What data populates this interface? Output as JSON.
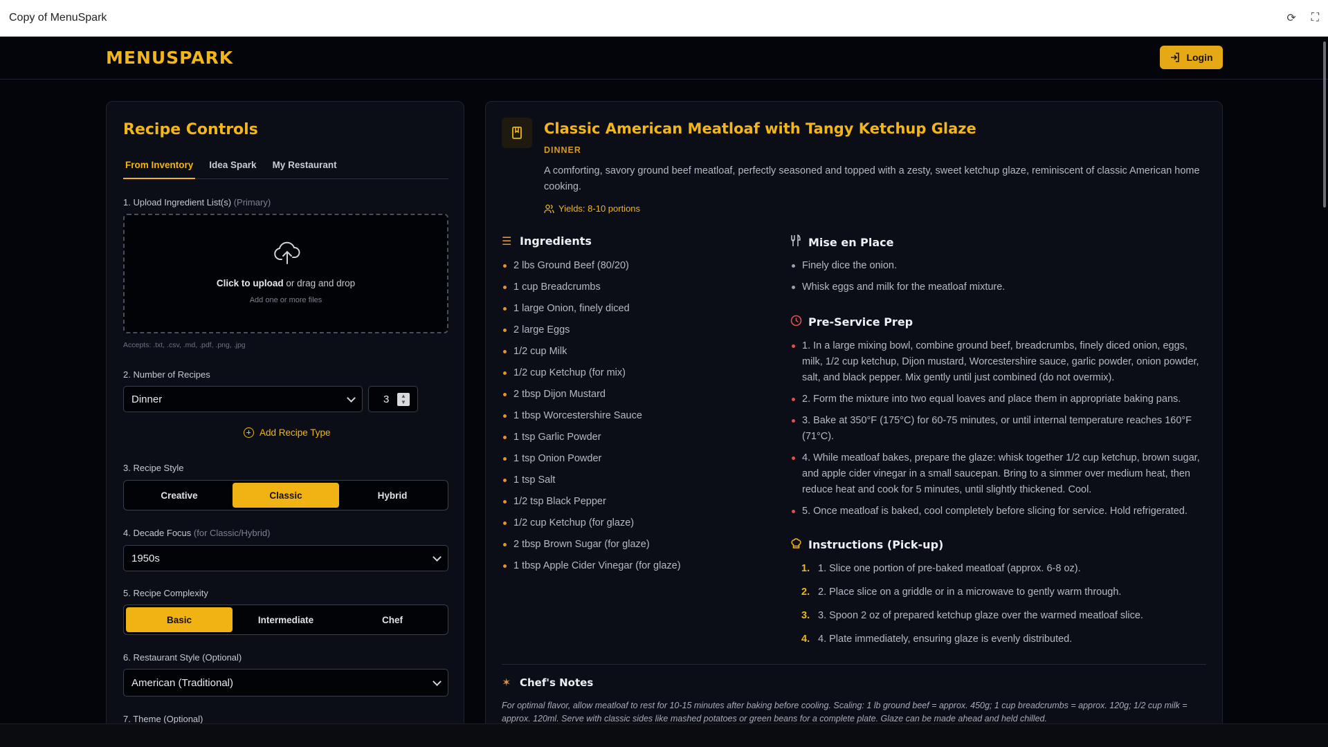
{
  "window": {
    "title": "Copy of MenuSpark",
    "refresh_icon": "refresh-icon",
    "fullscreen_icon": "fullscreen-icon"
  },
  "header": {
    "logo": "MENUSPARK",
    "login_label": "Login"
  },
  "controls": {
    "title": "Recipe Controls",
    "tabs": [
      {
        "label": "From Inventory",
        "active": true
      },
      {
        "label": "Idea Spark",
        "active": false
      },
      {
        "label": "My Restaurant",
        "active": false
      }
    ],
    "upload": {
      "label": "1. Upload Ingredient List(s)",
      "label_hint": "(Primary)",
      "click_text": "Click to upload",
      "drag_text": " or drag and drop",
      "sub_text": "Add one or more files",
      "accepts": "Accepts: .txt, .csv, .md, .pdf, .png, .jpg"
    },
    "num_recipes": {
      "label": "2. Number of Recipes",
      "type_value": "Dinner",
      "count": "3",
      "add_label": "Add Recipe Type"
    },
    "style": {
      "label": "3. Recipe Style",
      "options": [
        "Creative",
        "Classic",
        "Hybrid"
      ],
      "selected": "Classic"
    },
    "decade": {
      "label": "4. Decade Focus",
      "label_hint": "(for Classic/Hybrid)",
      "value": "1950s"
    },
    "complexity": {
      "label": "5. Recipe Complexity",
      "options": [
        "Basic",
        "Intermediate",
        "Chef"
      ],
      "selected": "Basic"
    },
    "restaurant_style": {
      "label": "6. Restaurant Style (Optional)",
      "value": "American (Traditional)"
    },
    "theme": {
      "label": "7. Theme (Optional)"
    }
  },
  "recipe": {
    "title": "Classic American Meatloaf with Tangy Ketchup Glaze",
    "type": "DINNER",
    "description": "A comforting, savory ground beef meatloaf, perfectly seasoned and topped with a zesty, sweet ketchup glaze, reminiscent of classic American home cooking.",
    "yields": "Yields: 8-10 portions",
    "ingredients_title": "Ingredients",
    "ingredients": [
      "2 lbs Ground Beef (80/20)",
      "1 cup Breadcrumbs",
      "1 large Onion, finely diced",
      "2 large Eggs",
      "1/2 cup Milk",
      "1/2 cup Ketchup (for mix)",
      "2 tbsp Dijon Mustard",
      "1 tbsp Worcestershire Sauce",
      "1 tsp Garlic Powder",
      "1 tsp Onion Powder",
      "1 tsp Salt",
      "1/2 tsp Black Pepper",
      "1/2 cup Ketchup (for glaze)",
      "2 tbsp Brown Sugar (for glaze)",
      "1 tbsp Apple Cider Vinegar (for glaze)"
    ],
    "mise_title": "Mise en Place",
    "mise": [
      "Finely dice the onion.",
      "Whisk eggs and milk for the meatloaf mixture."
    ],
    "prep_title": "Pre-Service Prep",
    "prep": [
      "1. In a large mixing bowl, combine ground beef, breadcrumbs, finely diced onion, eggs, milk, 1/2 cup ketchup, Dijon mustard, Worcestershire sauce, garlic powder, onion powder, salt, and black pepper. Mix gently until just combined (do not overmix).",
      "2. Form the mixture into two equal loaves and place them in appropriate baking pans.",
      "3. Bake at 350°F (175°C) for 60-75 minutes, or until internal temperature reaches 160°F (71°C).",
      "4. While meatloaf bakes, prepare the glaze: whisk together 1/2 cup ketchup, brown sugar, and apple cider vinegar in a small saucepan. Bring to a simmer over medium heat, then reduce heat and cook for 5 minutes, until slightly thickened. Cool.",
      "5. Once meatloaf is baked, cool completely before slicing for service. Hold refrigerated."
    ],
    "instructions_title": "Instructions (Pick-up)",
    "instructions": [
      {
        "n": "1.",
        "text": "1. Slice one portion of pre-baked meatloaf (approx. 6-8 oz)."
      },
      {
        "n": "2.",
        "text": "2. Place slice on a griddle or in a microwave to gently warm through."
      },
      {
        "n": "3.",
        "text": "3. Spoon 2 oz of prepared ketchup glaze over the warmed meatloaf slice."
      },
      {
        "n": "4.",
        "text": "4. Plate immediately, ensuring glaze is evenly distributed."
      }
    ],
    "notes_title": "Chef's Notes",
    "notes": "For optimal flavor, allow meatloaf to rest for 10-15 minutes after baking before cooling. Scaling: 1 lb ground beef = approx. 450g; 1 cup breadcrumbs = approx. 120g; 1/2 cup milk = approx. 120ml. Serve with classic sides like mashed potatoes or green beans for a complete plate. Glaze can be made ahead and held chilled."
  },
  "colors": {
    "accent": "#f2b61a",
    "background": "#04050a",
    "panel": "#0b0e17"
  }
}
